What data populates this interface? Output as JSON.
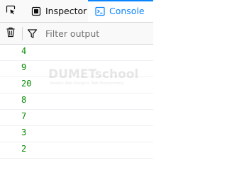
{
  "tabs": {
    "inspector_label": "Inspector",
    "console_label": "Console"
  },
  "toolbar": {
    "filter_placeholder": "Filter output",
    "filter_value": ""
  },
  "console": {
    "values": [
      "4",
      "9",
      "20",
      "8",
      "7",
      "3",
      "2"
    ],
    "value_color": "#058b00"
  },
  "watermark": {
    "text": "DUMETschool",
    "subtext": "Sekolah Web Design & Web Programming"
  },
  "colors": {
    "accent": "#0a84ff",
    "toolbar_bg": "#f9f9fa",
    "border": "#d7d7db"
  },
  "icons": {
    "picker": "element-picker-icon",
    "inspector": "inspector-icon",
    "console": "console-icon",
    "trash": "trash-icon",
    "filter": "filter-icon"
  }
}
